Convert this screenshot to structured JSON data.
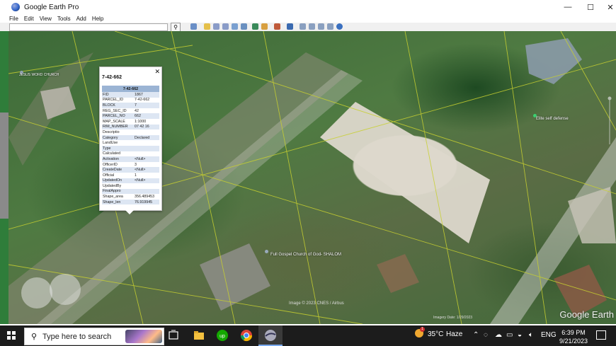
{
  "window": {
    "title": "Google Earth Pro",
    "minimize_label": "—",
    "maximize_label": "☐",
    "close_label": "✕"
  },
  "menubar": {
    "items": [
      "File",
      "Edit",
      "View",
      "Tools",
      "Add",
      "Help"
    ]
  },
  "toolbar": {
    "search_value": "",
    "search_icon": "search-icon"
  },
  "balloon": {
    "title": "7-42-662",
    "close_label": "✕",
    "header": "7-42-662",
    "rows": [
      {
        "key": "FID",
        "value": "1867"
      },
      {
        "key": "PARCEL_ID",
        "value": "7-42-662"
      },
      {
        "key": "BLOCK",
        "value": "7"
      },
      {
        "key": "REG_SEC_ID",
        "value": "42"
      },
      {
        "key": "PARCEL_NO",
        "value": "662"
      },
      {
        "key": "MAP_SCALE",
        "value": "1:1000"
      },
      {
        "key": "RIM_NUMBER",
        "value": "07 42 16"
      },
      {
        "key": "Descriptio",
        "value": ""
      },
      {
        "key": "Category",
        "value": "Declared"
      },
      {
        "key": "LandUse",
        "value": ""
      },
      {
        "key": "Type",
        "value": ""
      },
      {
        "key": "Calculated",
        "value": ""
      },
      {
        "key": "Activation",
        "value": "<Null>"
      },
      {
        "key": "OfficerID",
        "value": "3"
      },
      {
        "key": "CreateDate",
        "value": "<Null>"
      },
      {
        "key": "Official",
        "value": "1"
      },
      {
        "key": "UpdatedOn",
        "value": "<Null>"
      },
      {
        "key": "UpdatedBy",
        "value": ""
      },
      {
        "key": "FinalAppro",
        "value": ""
      },
      {
        "key": "Shape_area",
        "value": "356.489453"
      },
      {
        "key": "Shape_len",
        "value": "76.919945"
      }
    ]
  },
  "map": {
    "places": [
      {
        "label": "Elite self defense"
      },
      {
        "label": "Full Gospel Church of God- SHALOM"
      },
      {
        "label": "JESUS WORD CHURCH"
      }
    ],
    "imagery_credit": "Image © 2023 CNES / Airbus",
    "imagery_date": "Imagery Date: 1/29/2023",
    "watermark": "Google Earth"
  },
  "taskbar": {
    "search_placeholder": "Type here to search",
    "weather_temp": "35°C",
    "weather_desc": "Haze",
    "weather_badge": "1",
    "language": "ENG",
    "time": "6:39 PM",
    "date": "9/21/2023"
  }
}
